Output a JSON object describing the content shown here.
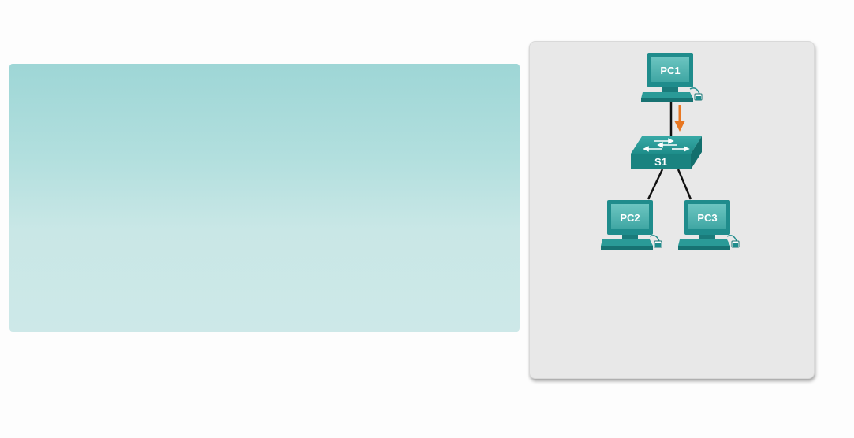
{
  "diagram": {
    "nodes": [
      {
        "id": "pc1",
        "type": "pc",
        "label": "PC1"
      },
      {
        "id": "s1",
        "type": "switch",
        "label": "S1"
      },
      {
        "id": "pc2",
        "type": "pc",
        "label": "PC2"
      },
      {
        "id": "pc3",
        "type": "pc",
        "label": "PC3"
      }
    ],
    "links": [
      {
        "from": "pc1",
        "to": "s1",
        "highlighted": true
      },
      {
        "from": "s1",
        "to": "pc2",
        "highlighted": false
      },
      {
        "from": "s1",
        "to": "pc3",
        "highlighted": false
      }
    ],
    "traffic_arrow": {
      "from": "pc1",
      "to": "s1",
      "color": "#e87722"
    }
  },
  "colors": {
    "device_teal": "#1f8c8c",
    "device_light": "#4fb3b0",
    "link": "#111111",
    "arrow": "#e87722",
    "panel_bg": "#e8e8e8"
  }
}
